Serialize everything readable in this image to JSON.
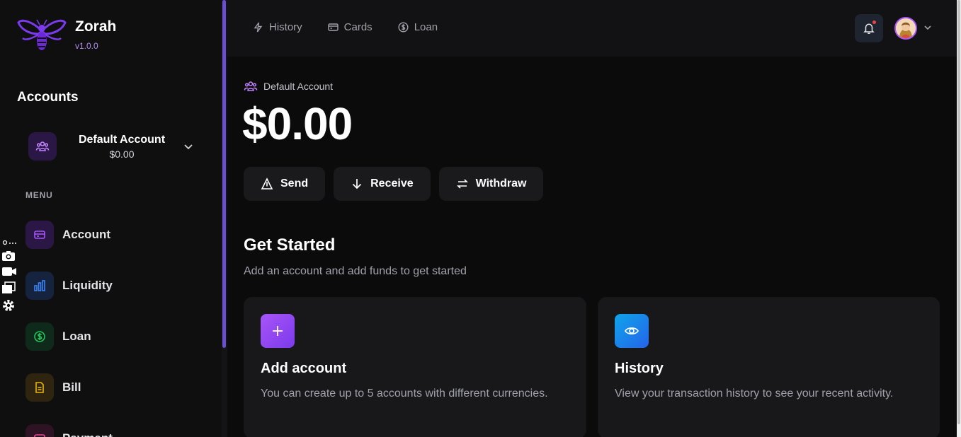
{
  "brand": {
    "name": "Zorah",
    "version": "v1.0.0"
  },
  "sidebar": {
    "accounts_title": "Accounts",
    "account": {
      "name": "Default Account",
      "balance": "$0.00"
    },
    "menu_label": "MENU",
    "items": [
      {
        "label": "Account",
        "icon": "card-icon",
        "color": "#a855f7",
        "bg": "#2a1745"
      },
      {
        "label": "Liquidity",
        "icon": "bar-chart-icon",
        "color": "#3b82f6",
        "bg": "#15233f"
      },
      {
        "label": "Loan",
        "icon": "dollar-icon",
        "color": "#22c55e",
        "bg": "#0f2a1a"
      },
      {
        "label": "Bill",
        "icon": "document-icon",
        "color": "#eab308",
        "bg": "#2e2410"
      },
      {
        "label": "Payment",
        "icon": "payment-icon",
        "color": "#ec4899",
        "bg": "#2e1325"
      }
    ]
  },
  "topbar": {
    "nav": [
      {
        "label": "History",
        "icon": "lightning-icon"
      },
      {
        "label": "Cards",
        "icon": "card-icon"
      },
      {
        "label": "Loan",
        "icon": "dollar-icon"
      }
    ]
  },
  "main": {
    "account_label": "Default Account",
    "balance": "$0.00",
    "actions": [
      {
        "label": "Send",
        "icon": "send-icon"
      },
      {
        "label": "Receive",
        "icon": "arrow-down-icon"
      },
      {
        "label": "Withdraw",
        "icon": "swap-icon"
      }
    ],
    "get_started": {
      "title": "Get Started",
      "subtitle": "Add an account and add funds to get started"
    },
    "cards": [
      {
        "title": "Add account",
        "desc": "You can create up to 5 accounts with different currencies.",
        "icon": "plus-icon"
      },
      {
        "title": "History",
        "desc": "View your transaction history to see your recent activity.",
        "icon": "eye-icon"
      }
    ]
  },
  "colors": {
    "accent": "#a855f7",
    "background": "#0b0b0c",
    "sidebar": "#0f0f10"
  }
}
